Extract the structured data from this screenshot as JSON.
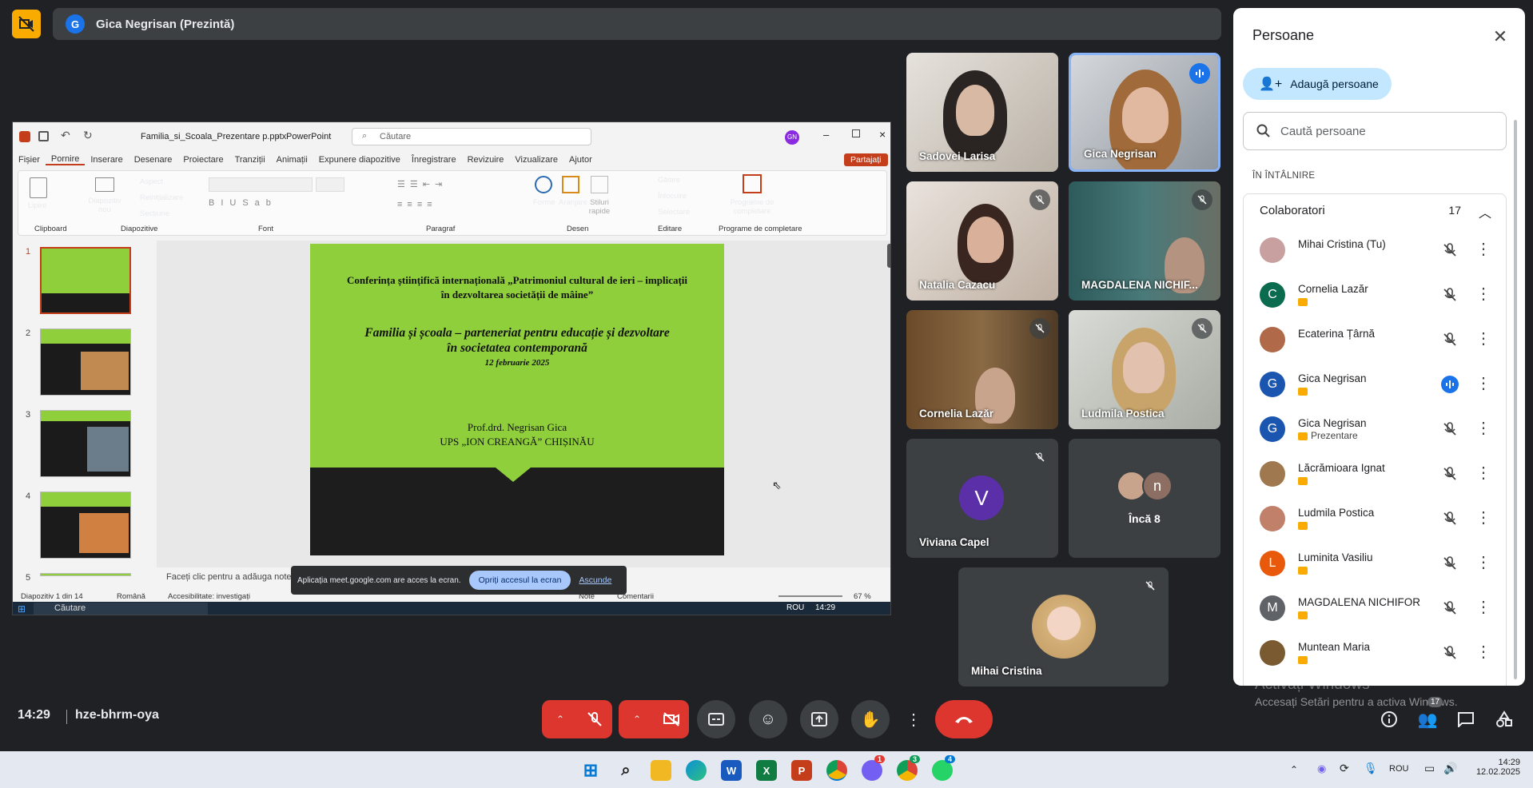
{
  "meet": {
    "presenter_initial": "G",
    "presenter_label": "Gica Negrisan (Prezintă)",
    "time": "14:29",
    "meeting_code": "hze-bhrm-oya",
    "participants_badge": "17"
  },
  "ppt": {
    "filename": "Familia_si_Scoala_Prezentare p.pptx",
    "app": "PowerPoint",
    "search_placeholder": "Căutare",
    "user_initials": "GN",
    "menu": [
      "Fișier",
      "Pornire",
      "Inserare",
      "Desenare",
      "Proiectare",
      "Tranziții",
      "Animații",
      "Expunere diapozitive",
      "Înregistrare",
      "Revizuire",
      "Vizualizare",
      "Ajutor"
    ],
    "share_button": "Partajați",
    "ribbon": {
      "paste": "Lipire",
      "new_slide": "Diapozitiv nou",
      "layout": "Aspect",
      "reset": "Reinițializare",
      "section": "Secțiune",
      "shapes": "Forme",
      "arrange": "Aranjare",
      "quick_styles": "Stiluri rapide",
      "find": "Găsire",
      "replace": "Înlocuire",
      "select": "Selectare",
      "addins": "Programe de completare",
      "group_clipboard": "Clipboard",
      "group_slides": "Diapozitive",
      "group_font": "Font",
      "group_paragraph": "Paragraf",
      "group_drawing": "Desen",
      "group_editing": "Editare",
      "group_addins": "Programe de completare"
    },
    "slide_numbers": [
      "1",
      "2",
      "3",
      "4",
      "5"
    ],
    "slide": {
      "line1": "Conferința științifică internațională „Patrimoniul cultural de ieri – implicații",
      "line2": "în dezvoltarea societății de mâine”",
      "line3": "Familia și școala – parteneriat pentru educație și dezvoltare",
      "line4": "în societatea contemporană",
      "date": "12 februarie 2025",
      "author": "Prof.drd. Negrisan Gica",
      "institution": "UPS „ION CREANGĂ” CHIȘINĂU"
    },
    "notes_placeholder": "Faceți clic pentru a adăuga note",
    "share_banner": {
      "text": "Aplicația meet.google.com are acces la ecran.",
      "stop": "Opriți accesul la ecran",
      "hide": "Ascunde"
    },
    "status": {
      "slide_of": "Diapozitiv 1 din 14",
      "lang": "Română",
      "accessibility": "Accesibilitate: investigați",
      "notes": "Note",
      "comments": "Comentarii",
      "zoom": "67 %"
    },
    "inner_taskbar": {
      "search": "Căutare",
      "lang": "ROU",
      "time": "14:29"
    }
  },
  "tiles": [
    {
      "name": "Sadovei Larisa",
      "muted": false
    },
    {
      "name": "Gica Negrisan",
      "muted": false,
      "speaking": true
    },
    {
      "name": "Natalia Cazacu",
      "muted": true
    },
    {
      "name": "MAGDALENA NICHIF...",
      "muted": true
    },
    {
      "name": "Cornelia Lazăr",
      "muted": true
    },
    {
      "name": "Ludmila Postica",
      "muted": true
    },
    {
      "name": "Viviana Capel",
      "initial": "V",
      "muted": true
    },
    {
      "name": "Încă 8",
      "initial": "n"
    },
    {
      "name": "Mihai Cristina",
      "muted": true
    }
  ],
  "panel": {
    "title": "Persoane",
    "add_people": "Adaugă persoane",
    "search_placeholder": "Caută persoane",
    "section": "În întâlnire",
    "group": "Colaboratori",
    "group_count": "17",
    "people": [
      {
        "name": "Mihai Cristina (Tu)",
        "initial": "",
        "color": "#c9a0a0",
        "badge": false,
        "sub": ""
      },
      {
        "name": "Cornelia Lazăr",
        "initial": "C",
        "color": "#0b6b4f",
        "badge": true,
        "sub": ""
      },
      {
        "name": "Ecaterina Țârnă",
        "initial": "",
        "color": "#b06a4a",
        "badge": false,
        "sub": ""
      },
      {
        "name": "Gica Negrisan",
        "initial": "G",
        "color": "#1a56b0",
        "badge": true,
        "sub": "",
        "speaking": true
      },
      {
        "name": "Gica Negrisan",
        "initial": "G",
        "color": "#1a56b0",
        "badge": true,
        "sub": "Prezentare"
      },
      {
        "name": "Lăcrămioara Ignat",
        "initial": "",
        "color": "#a07850",
        "badge": true,
        "sub": ""
      },
      {
        "name": "Ludmila Postica",
        "initial": "",
        "color": "#c0806a",
        "badge": true,
        "sub": ""
      },
      {
        "name": "Luminita Vasiliu",
        "initial": "L",
        "color": "#e8590c",
        "badge": true,
        "sub": ""
      },
      {
        "name": "MAGDALENA NICHIFOR",
        "initial": "M",
        "color": "#5f6368",
        "badge": true,
        "sub": ""
      },
      {
        "name": "Muntean Maria",
        "initial": "",
        "color": "#7a5a30",
        "badge": true,
        "sub": ""
      }
    ]
  },
  "watermark": {
    "line1": "Activați Windows",
    "line2": "Accesați Setări pentru a activa Windows."
  },
  "taskbar": {
    "time": "14:29",
    "date": "12.02.2025",
    "lang": "ROU",
    "badges": [
      "1",
      "3",
      "4"
    ]
  }
}
